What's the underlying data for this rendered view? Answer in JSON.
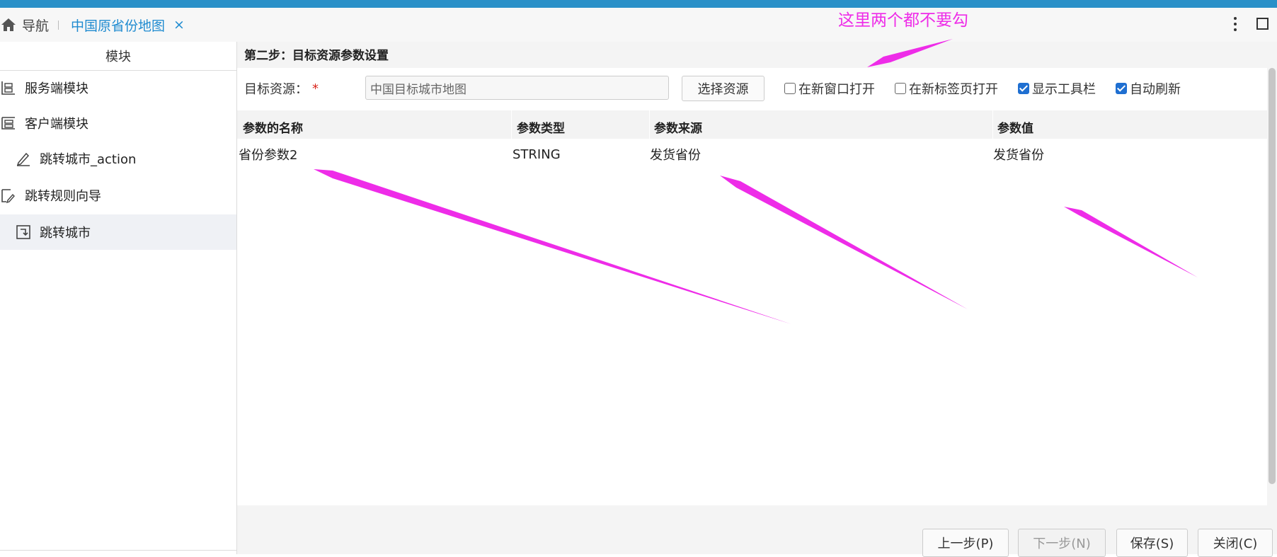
{
  "tabs": {
    "home_label": "导航",
    "active_tab_label": "中国原省份地图",
    "close_glyph": "×"
  },
  "sidebar": {
    "header": "模块",
    "items": [
      {
        "label": "服务端模块",
        "icon": "server-module-icon"
      },
      {
        "label": "客户端模块",
        "icon": "client-module-icon"
      },
      {
        "label": "跳转城市_action",
        "icon": "edit-pen-icon"
      },
      {
        "label": "跳转规则向导",
        "icon": "rule-wizard-icon"
      },
      {
        "label": "跳转城市",
        "icon": "jump-link-icon",
        "selected": true
      }
    ]
  },
  "main": {
    "step_title": "第二步：目标资源参数设置",
    "target_resource": {
      "label": "目标资源：",
      "required_mark": "*",
      "value": "中国目标城市地图"
    },
    "select_resource_button": "选择资源",
    "options": [
      {
        "label": "在新窗口打开",
        "checked": false
      },
      {
        "label": "在新标签页打开",
        "checked": false
      },
      {
        "label": "显示工具栏",
        "checked": true
      },
      {
        "label": "自动刷新",
        "checked": true
      }
    ],
    "table": {
      "columns": [
        "参数的名称",
        "参数类型",
        "参数来源",
        "参数值"
      ],
      "rows": [
        [
          "省份参数2",
          "STRING",
          "发货省份",
          "发货省份"
        ]
      ]
    },
    "buttons": {
      "prev": "上一步(P)",
      "next": "下一步(N)",
      "save": "保存(S)",
      "close": "关闭(C)"
    }
  },
  "annotation": {
    "text": "这里两个都不要勾",
    "color": "#ee2ce8"
  },
  "colors": {
    "accent_blue": "#2a90c8",
    "tab_active_text": "#1f8bd0",
    "checkbox_checked": "#1f6fd1",
    "required_star": "#d9251c"
  }
}
